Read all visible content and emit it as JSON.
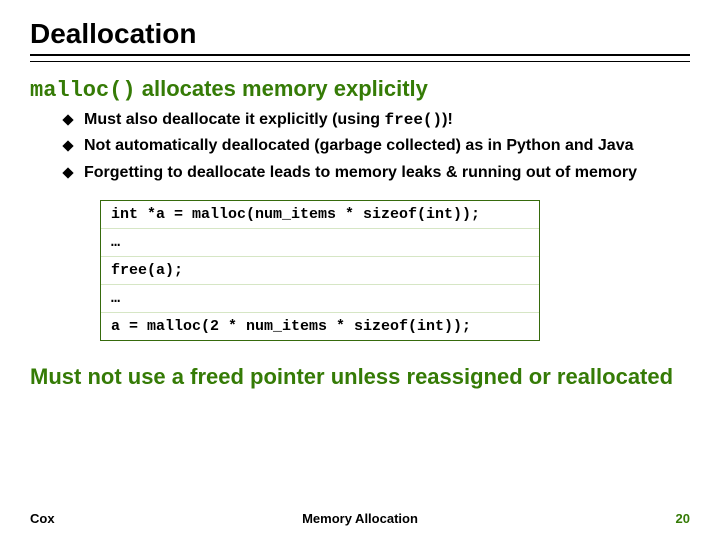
{
  "title": "Deallocation",
  "heading": {
    "code": "malloc()",
    "rest": " allocates memory explicitly"
  },
  "bullets": [
    {
      "pre": "Must also deallocate it explicitly (using ",
      "code": "free()",
      "post": ")!"
    },
    {
      "pre": "Not automatically deallocated (garbage collected) as in Python and Java",
      "code": "",
      "post": ""
    },
    {
      "pre": "Forgetting to deallocate leads to memory leaks & running out of memory",
      "code": "",
      "post": ""
    }
  ],
  "code_lines": [
    "int *a = malloc(num_items * sizeof(int));",
    "…",
    "free(a);",
    "…",
    "a = malloc(2 * num_items * sizeof(int));"
  ],
  "warning": "Must not use a freed pointer unless reassigned or reallocated",
  "footer": {
    "left": "Cox",
    "center": "Memory Allocation",
    "right": "20"
  }
}
